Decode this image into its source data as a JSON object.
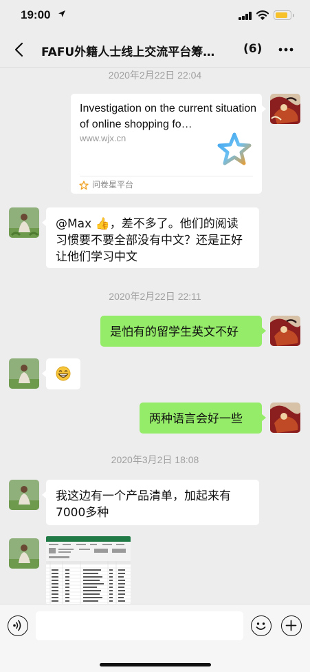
{
  "status_bar": {
    "time": "19:00",
    "location_icon": "location-arrow-icon",
    "signal_icon": "cellular-signal-icon",
    "wifi_icon": "wifi-icon",
    "battery_icon": "battery-icon",
    "battery_color": "#f6c12b"
  },
  "header": {
    "title": "FAFU外籍人士线上交流平台筹…",
    "member_count": "(6)",
    "back_icon": "chevron-left-icon",
    "more_icon": "more-dots-icon"
  },
  "messages": {
    "ts1": "2020年2月22日 22:04",
    "link_card": {
      "title": "Investigation on the current situation of online shopping fo…",
      "url": "www.wjx.cn",
      "source": "问卷星平台",
      "thumb_icon": "star-logo-icon"
    },
    "msg2": {
      "mention": "@Max ",
      "text": "，差不多了。他们的阅读习惯要不要全部没有中文？还是正好让他们学习中文",
      "emoji": "👍"
    },
    "ts2": "2020年2月22日 22:11",
    "msg3": "是怕有的留学生英文不好",
    "msg4": {
      "emoji": "grinning-face-icon"
    },
    "msg5": "两种语言会好一些",
    "ts3": "2020年3月2日 18:08",
    "msg6": "我这边有一个产品清单，加起来有7000多种",
    "msg7": {
      "type": "image",
      "description": "excel-spreadsheet-thumbnail"
    }
  },
  "input_bar": {
    "placeholder": "",
    "voice_icon": "voice-icon",
    "emoji_icon": "emoji-face-icon",
    "plus_icon": "plus-circle-icon"
  },
  "colors": {
    "background": "#ededed",
    "sent_bubble": "#95ec69",
    "received_bubble": "#ffffff",
    "timestamp": "#a0a0a0"
  }
}
